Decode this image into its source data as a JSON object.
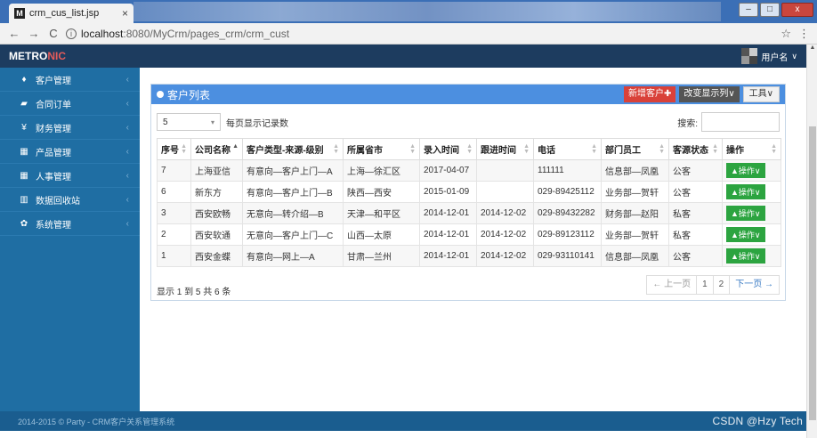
{
  "browser": {
    "tab_title": "crm_cus_list.jsp",
    "tab_favicon": "M",
    "tab_close": "×",
    "url_host": "localhost",
    "url_path": ":8080/MyCrm/pages_crm/crm_cust",
    "back_icon": "←",
    "forward_icon": "→",
    "reload_icon": "C",
    "info_icon": "i",
    "star_icon": "☆",
    "menu_icon": "⋮",
    "minimize": "–",
    "maximize": "□",
    "close": "x"
  },
  "header": {
    "logo_main": "METRO",
    "logo_accent": "NIC",
    "username": "用户名",
    "chevron": "∨"
  },
  "sidebar": {
    "items": [
      {
        "label": "客户管理",
        "icon": "person-icon",
        "glyph": "♦"
      },
      {
        "label": "合同订单",
        "icon": "book-icon",
        "glyph": "▰"
      },
      {
        "label": "财务管理",
        "icon": "yen-icon",
        "glyph": "¥"
      },
      {
        "label": "产品管理",
        "icon": "table-icon",
        "glyph": "▦"
      },
      {
        "label": "人事管理",
        "icon": "table-icon",
        "glyph": "▦"
      },
      {
        "label": "数据回收站",
        "icon": "trash-icon",
        "glyph": "▥"
      },
      {
        "label": "系统管理",
        "icon": "gear-icon",
        "glyph": "✿"
      }
    ],
    "arrow": "‹"
  },
  "portlet": {
    "title": "客户列表",
    "add_button": "新增客户✚",
    "columns_button": "改变显示列∨",
    "tools_button": "工具∨"
  },
  "toolbar": {
    "page_size": "5",
    "caret": "▾",
    "per_page_label": "每页显示记录数",
    "search_label": "搜索:",
    "search_value": ""
  },
  "table": {
    "headers": [
      "序号",
      "公司名称",
      "客户类型-来源-级别",
      "所属省市",
      "录入时间",
      "跟进时间",
      "电话",
      "部门员工",
      "客源状态",
      "操作"
    ],
    "rows": [
      [
        "7",
        "上海亚信",
        "有意向—客户上门—A",
        "上海—徐汇区",
        "2017-04-07",
        "",
        "111111",
        "信息部—凤凰",
        "公客",
        "▲操作∨"
      ],
      [
        "6",
        "新东方",
        "有意向—客户上门—B",
        "陕西—西安",
        "2015-01-09",
        "",
        "029-89425112",
        "业务部—贺轩",
        "公客",
        "▲操作∨"
      ],
      [
        "3",
        "西安欧畅",
        "无意向—转介绍—B",
        "天津—和平区",
        "2014-12-01",
        "2014-12-02",
        "029-89432282",
        "财务部—赵阳",
        "私客",
        "▲操作∨"
      ],
      [
        "2",
        "西安软通",
        "无意向—客户上门—C",
        "山西—太原",
        "2014-12-01",
        "2014-12-02",
        "029-89123112",
        "业务部—贺轩",
        "私客",
        "▲操作∨"
      ],
      [
        "1",
        "西安金蝶",
        "有意向—网上—A",
        "甘肃—兰州",
        "2014-12-01",
        "2014-12-02",
        "029-93110141",
        "信息部—凤凰",
        "公客",
        "▲操作∨"
      ]
    ]
  },
  "footer": {
    "info": "显示 1 到 5 共 6 条",
    "prev": "← 上一页",
    "page1": "1",
    "page2": "2",
    "next": "下一页 →",
    "copyright": "2014-2015 © Party - CRM客户关系管理系统",
    "watermark": "CSDN @Hzy Tech"
  },
  "colors": {
    "header_bg": "#1d3c5f",
    "sidebar_bg": "#1f6ea3",
    "portlet_head": "#4c8fe0",
    "add_button": "#d94139",
    "op_button": "#2ca440"
  }
}
